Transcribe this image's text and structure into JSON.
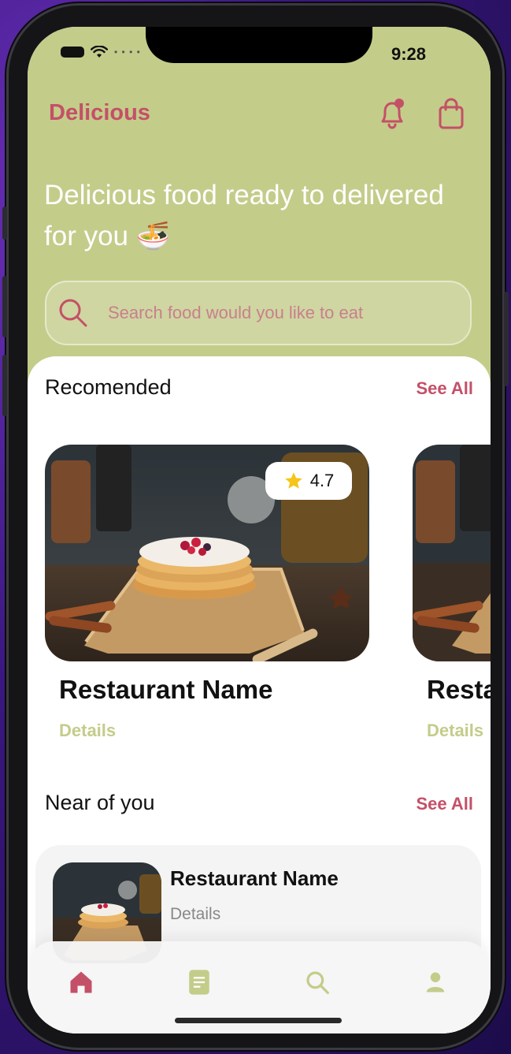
{
  "status": {
    "time": "9:28"
  },
  "header": {
    "brand": "Delicious"
  },
  "hero": {
    "title_line1": "Delicious food ready to delivered",
    "title_line2": "for you 🍜"
  },
  "search": {
    "placeholder": "Search food would you like to eat"
  },
  "recommended": {
    "title": "Recomended",
    "see_all": "See All",
    "cards": [
      {
        "name": "Restaurant Name",
        "details": "Details",
        "rating": "4.7"
      },
      {
        "name": "Resta",
        "details": "Details"
      }
    ]
  },
  "near": {
    "title": "Near of you",
    "see_all": "See All",
    "items": [
      {
        "name": "Restaurant Name",
        "details": "Details"
      }
    ]
  },
  "tabs": [
    {
      "name": "home",
      "icon": "home-icon",
      "active": true
    },
    {
      "name": "orders",
      "icon": "document-icon"
    },
    {
      "name": "search",
      "icon": "search-icon"
    },
    {
      "name": "profile",
      "icon": "user-icon"
    }
  ],
  "colors": {
    "accent": "#c45068",
    "hero_bg": "#c4cc8a",
    "muted_green": "#c4cc8a",
    "text_dark": "#111111"
  }
}
